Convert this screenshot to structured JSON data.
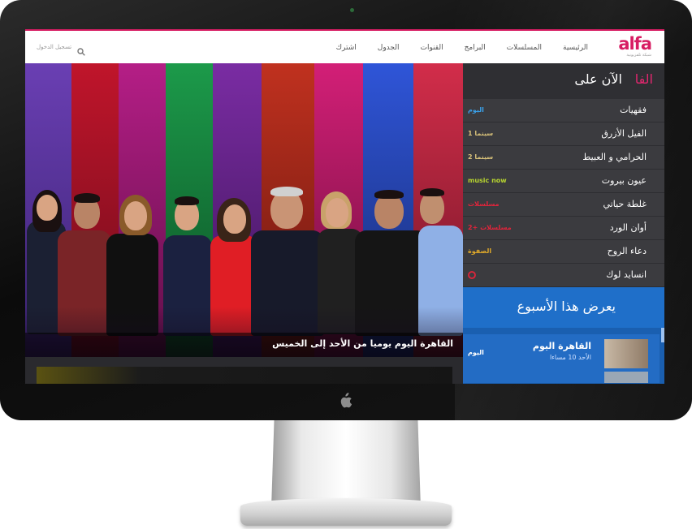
{
  "brand": {
    "logo_text": "alfa",
    "logo_sub": "شبكة تلفزيونية",
    "accent": "#d71d63"
  },
  "nav": {
    "items": [
      "الرئيسية",
      "المسلسلات",
      "البرامج",
      "القنوات",
      "الجدول",
      "اشترك"
    ],
    "login": "تسجيل الدخول",
    "search_icon": "search-icon"
  },
  "hero": {
    "caption": "القاهرة اليوم يوميا من الأحد إلى الخميس"
  },
  "now_on": {
    "title_prefix": "الآن على",
    "title_accent": "الفا",
    "rows": [
      {
        "title": "فقهيات",
        "channel": "اليوم",
        "channel_color": "#3aa0e8"
      },
      {
        "title": "الفيل الأزرق",
        "channel": "سينما 1",
        "channel_color": "#d9c27a"
      },
      {
        "title": "الحرامي و العبيط",
        "channel": "سينما 2",
        "channel_color": "#d9c27a"
      },
      {
        "title": "عيون بيروت",
        "channel": "music now",
        "channel_color": "#b7d430"
      },
      {
        "title": "غلطة حياتي",
        "channel": "مسلسلات",
        "channel_color": "#e2243b"
      },
      {
        "title": "أوان الورد",
        "channel": "مسلسلات +2",
        "channel_color": "#e2243b"
      },
      {
        "title": "دعاء الروح",
        "channel": "الصفوة",
        "channel_color": "#e0a92a"
      },
      {
        "title": "انسايد لوك",
        "channel": "",
        "channel_color": "#e2243b"
      }
    ]
  },
  "this_week": {
    "title": "يعرض هذا الأسبوع",
    "show_title": "القاهرة اليوم",
    "show_time": "الأحد 10 مساءا",
    "channel": "اليوم"
  }
}
